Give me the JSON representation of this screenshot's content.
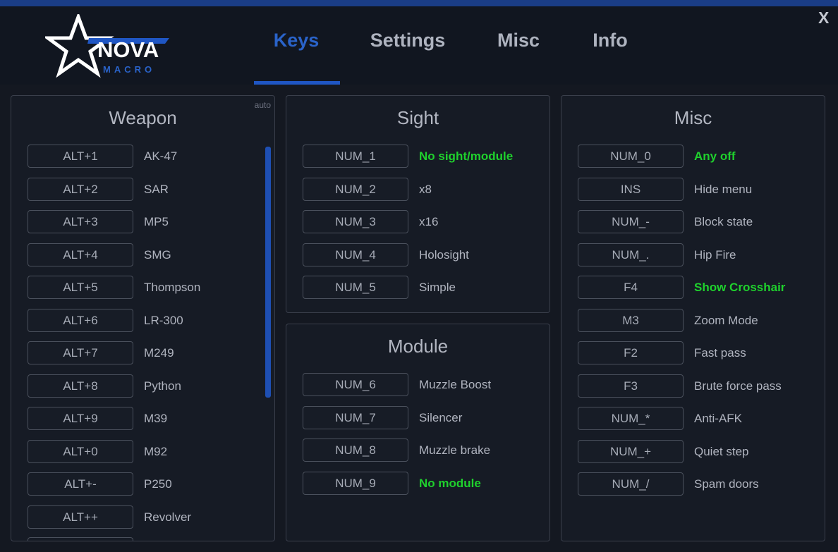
{
  "window": {
    "close_label": "X"
  },
  "logo": {
    "text": "NOVA",
    "sub": "MACRO"
  },
  "tabs": [
    {
      "label": "Keys",
      "active": true
    },
    {
      "label": "Settings",
      "active": false
    },
    {
      "label": "Misc",
      "active": false
    },
    {
      "label": "Info",
      "active": false
    }
  ],
  "colors": {
    "accent": "#1f56c4",
    "active_green": "#1fd12d",
    "background": "#141821"
  },
  "weapon": {
    "title": "Weapon",
    "auto_label": "auto",
    "rows": [
      {
        "key": "ALT+1",
        "label": "AK-47"
      },
      {
        "key": "ALT+2",
        "label": "SAR"
      },
      {
        "key": "ALT+3",
        "label": "MP5"
      },
      {
        "key": "ALT+4",
        "label": "SMG"
      },
      {
        "key": "ALT+5",
        "label": "Thompson"
      },
      {
        "key": "ALT+6",
        "label": "LR-300"
      },
      {
        "key": "ALT+7",
        "label": "M249"
      },
      {
        "key": "ALT+8",
        "label": "Python"
      },
      {
        "key": "ALT+9",
        "label": "M39"
      },
      {
        "key": "ALT+0",
        "label": "M92"
      },
      {
        "key": "ALT+-",
        "label": "P250"
      },
      {
        "key": "ALT++",
        "label": "Revolver"
      }
    ]
  },
  "sight": {
    "title": "Sight",
    "rows": [
      {
        "key": "NUM_1",
        "label": "No sight/module",
        "active": true
      },
      {
        "key": "NUM_2",
        "label": "x8"
      },
      {
        "key": "NUM_3",
        "label": "x16"
      },
      {
        "key": "NUM_4",
        "label": "Holosight"
      },
      {
        "key": "NUM_5",
        "label": "Simple"
      }
    ]
  },
  "module": {
    "title": "Module",
    "rows": [
      {
        "key": "NUM_6",
        "label": "Muzzle Boost"
      },
      {
        "key": "NUM_7",
        "label": "Silencer"
      },
      {
        "key": "NUM_8",
        "label": "Muzzle brake"
      },
      {
        "key": "NUM_9",
        "label": "No module",
        "active": true
      }
    ]
  },
  "misc": {
    "title": "Misc",
    "rows": [
      {
        "key": "NUM_0",
        "label": "Any off",
        "active": true
      },
      {
        "key": "INS",
        "label": "Hide menu"
      },
      {
        "key": "NUM_-",
        "label": "Block state"
      },
      {
        "key": "NUM_.",
        "label": "Hip Fire"
      },
      {
        "key": "F4",
        "label": "Show Crosshair",
        "active": true
      },
      {
        "key": "M3",
        "label": "Zoom Mode"
      },
      {
        "key": "F2",
        "label": "Fast pass"
      },
      {
        "key": "F3",
        "label": "Brute force pass"
      },
      {
        "key": "NUM_*",
        "label": "Anti-AFK"
      },
      {
        "key": "NUM_+",
        "label": "Quiet step"
      },
      {
        "key": "NUM_/",
        "label": "Spam doors"
      }
    ]
  }
}
